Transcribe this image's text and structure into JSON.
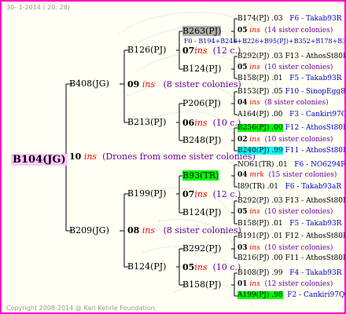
{
  "meta": {
    "stamp": "30- 1-2014 ( 20: 28)",
    "copyright": "Copyright 2008-2014 @ Karl Kehrle Foundation."
  },
  "root": {
    "name": "B104(JG)",
    "ins": "10",
    "ins_word": "ins",
    "note": "(Drones from some sister colonies)"
  },
  "gen1": {
    "top": {
      "name": "B408(JG)",
      "ins": "09",
      "ins_word": "ins",
      "note": "(8 sister colonies)"
    },
    "bottom": {
      "name": "B209(JG)",
      "ins": "08",
      "ins_word": "ins",
      "note": "(8 sister colonies)"
    }
  },
  "gen2": [
    {
      "name": "B126(PJ)",
      "ins": "07",
      "ins_word": "ins",
      "count": "(12 c.)"
    },
    {
      "name": "B213(PJ)",
      "ins": "06",
      "ins_word": "ins",
      "count": "(10 c.)"
    },
    {
      "name": "B199(PJ)",
      "ins": "07",
      "ins_word": "ins",
      "count": "(12 c.)"
    },
    {
      "name": "B124(PJ)",
      "ins": "05",
      "ins_word": "ins",
      "count": "(10 c.)"
    }
  ],
  "gen3": [
    {
      "name": "B263(PJ)",
      "highlight": "#b0b0b0",
      "ins": "05",
      "ins_word": "ins",
      "note": "(14 sister colonies)"
    },
    {
      "name": "B124(PJ)",
      "ins": "05",
      "ins_word": "ins",
      "note": "(10 sister colonies)"
    },
    {
      "name": "P206(PJ)",
      "ins": "04",
      "ins_word": "ins",
      "note": "(8 sister colonies)"
    },
    {
      "name": "B248(PJ)",
      "ins": "02",
      "ins_word": "ins",
      "note": "(10 sister colonies)"
    },
    {
      "name": "B93(TR)",
      "highlight": "#00ff00",
      "ins": "04",
      "ins_word": "mrk",
      "note": "(15 sister colonies)"
    },
    {
      "name": "B124(PJ)",
      "ins": "05",
      "ins_word": "ins",
      "note": "(10 sister colonies)"
    },
    {
      "name": "B292(PJ)",
      "ins": "03",
      "ins_word": "ins",
      "note": "(10 sister colonies)"
    },
    {
      "name": "B158(PJ)",
      "ins": "01",
      "ins_word": "ins",
      "note": "(12 sister colonies)"
    }
  ],
  "leaves": [
    {
      "text": "B174(PJ) .03",
      "tail": "F6 - Takab93R"
    },
    {
      "text": "F0 - B194+B248+B226+B95(PJ)+B352+B178+B354",
      "blue": true
    },
    {
      "text": "B292(PJ) .03 F13 - AthosSt80R"
    },
    {
      "text": "B158(PJ) .01",
      "tail": "F5 - Takab93R"
    },
    {
      "text": "B153(PJ) .05",
      "tail": "F10 - SinopEgg86R"
    },
    {
      "text": "A164(PJ) .00",
      "tail": "F3 - Cankiri97Q"
    },
    {
      "text": "B256(PJ) .00",
      "highlight": "#00ff00",
      "tail": "F12 - AthosSt80R"
    },
    {
      "text": "B240(PJ) .99",
      "highlight": "#00ffff",
      "tail": "F11 - AthosSt80R"
    },
    {
      "text": "NO61(TR) .01",
      "tail": "F6 - NO6294R"
    },
    {
      "text": "I89(TR) .01",
      "tail": "F6 - Takab93aR"
    },
    {
      "text": "B292(PJ) .03 F13 - AthosSt80R"
    },
    {
      "text": "B158(PJ) .01",
      "tail": "F5 - Takab93R"
    },
    {
      "text": "B191(PJ) .01 F12 - AthosSt80R"
    },
    {
      "text": "B216(PJ) .00 F11 - AthosSt80R"
    },
    {
      "text": "B108(PJ) .99",
      "tail": "F4 - Takab93R"
    },
    {
      "text": "A199(PJ) .98",
      "highlight": "#00ff00",
      "tail": "F2 - Cankiri97Q"
    }
  ]
}
